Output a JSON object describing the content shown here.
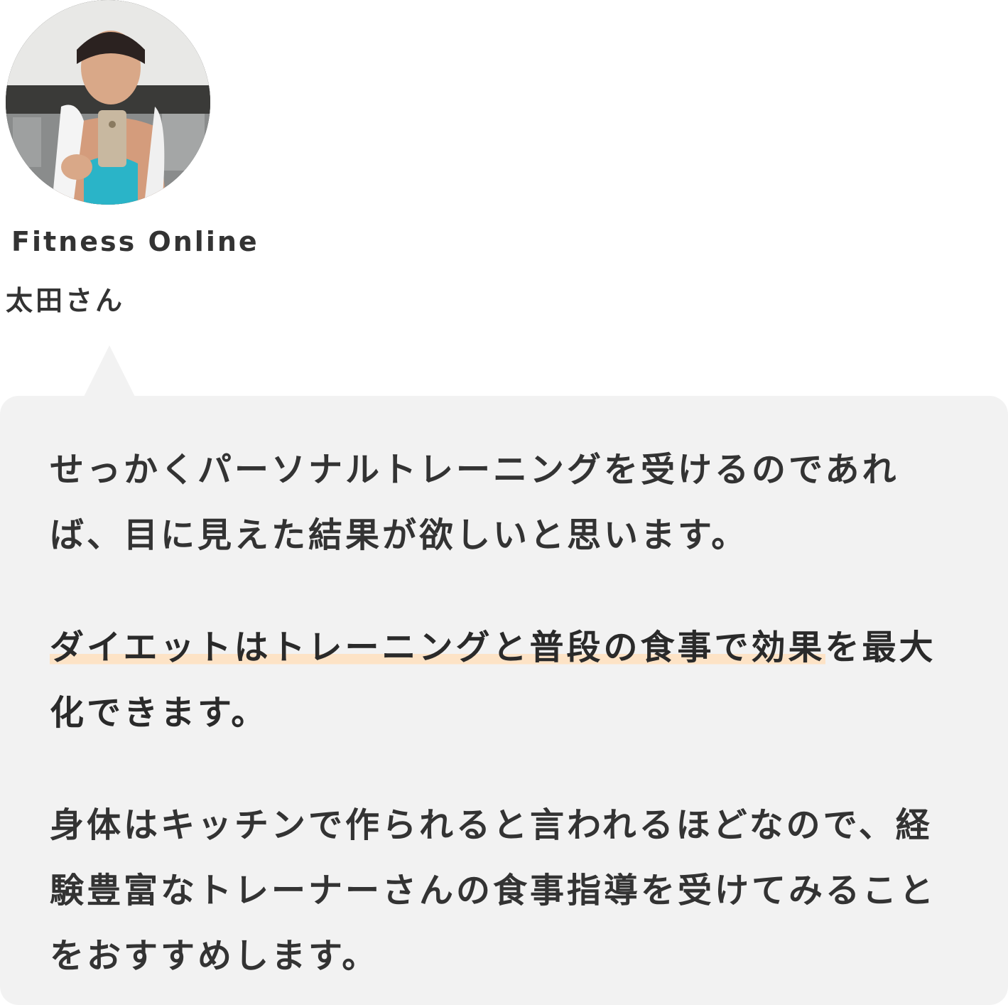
{
  "profile": {
    "brand": "Fitness Online",
    "name": "太田さん",
    "avatar_icon": "trainer-photo"
  },
  "message": {
    "paragraph_1": "せっかくパーソナルトレーニングを受けるのであれば、目に見えた結果が欲しいと思います。",
    "paragraph_2_highlight": "ダイエットはトレーニングと普段の食事で効果",
    "paragraph_2_rest": "を最大化できます。",
    "paragraph_3": "身体はキッチンで作られると言われるほどなので、経験豊富なトレーナーさんの食事指導を受けてみることをおすすめします。"
  },
  "colors": {
    "text": "#333333",
    "bubble_background": "#f2f2f2",
    "highlight": "#fde3c6"
  }
}
